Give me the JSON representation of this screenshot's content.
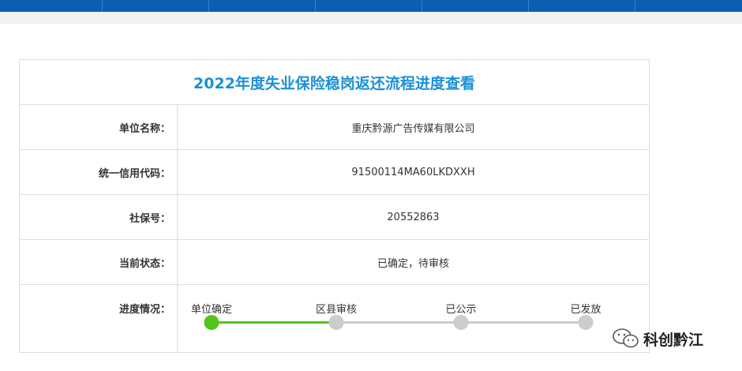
{
  "page": {
    "title": "2022年度失业保险稳岗返还流程进度查看"
  },
  "details": [
    {
      "label": "单位名称：",
      "value": "重庆黔源广告传媒有限公司"
    },
    {
      "label": "统一信用代码：",
      "value": "91500114MA60LKDXXH"
    },
    {
      "label": "社保号：",
      "value": "20552863"
    },
    {
      "label": "当前状态：",
      "value": "已确定，待审核"
    }
  ],
  "progress": {
    "label": "进度情况：",
    "steps": [
      "单位确定",
      "区县审核",
      "已公示",
      "已发放"
    ],
    "completed_steps": 1
  },
  "watermark": {
    "text": "科创黔江"
  },
  "colors": {
    "nav": "#0b5fb3",
    "title": "#1a91d6",
    "done": "#52c41a",
    "pending": "#cccccc"
  }
}
